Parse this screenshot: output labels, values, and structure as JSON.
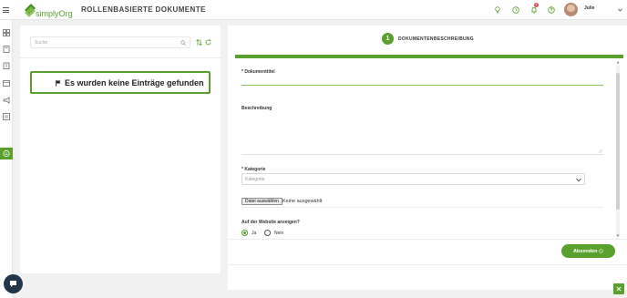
{
  "header": {
    "logo_text": "simplyOrg",
    "page_title": "ROLLENBASIERTE DOKUMENTE",
    "notification_count": "1",
    "user_name": "Julie"
  },
  "colors": {
    "accent": "#5aa02c",
    "badge": "#d9534f",
    "chat": "#22364a"
  },
  "header_icons": [
    "lightbulb-icon",
    "clock-icon",
    "bell-icon",
    "help-icon"
  ],
  "rail_icons": [
    "dashboard-icon",
    "book-icon",
    "building-icon",
    "calendar-icon",
    "megaphone-icon",
    "list-icon",
    "documents-icon"
  ],
  "left_panel": {
    "search_placeholder": "Suche",
    "empty_message": "Es wurden keine Einträge gefunden"
  },
  "form": {
    "step_number": "1",
    "step_label": "DOKUMENTENBESCHREIBUNG",
    "title_label": "Dokumenttitel",
    "required_mark": "*",
    "description_label": "Beschreibung",
    "category_label": "Kategorie",
    "category_placeholder": "Kategorie",
    "file_button_label": "Datei auswählen",
    "file_status": "Keine ausgewählt",
    "website_label": "Auf der Website anzeigen?",
    "radio_yes": "Ja",
    "radio_no": "Nein",
    "website_selected": "Ja",
    "submit_label": "Absenden"
  }
}
